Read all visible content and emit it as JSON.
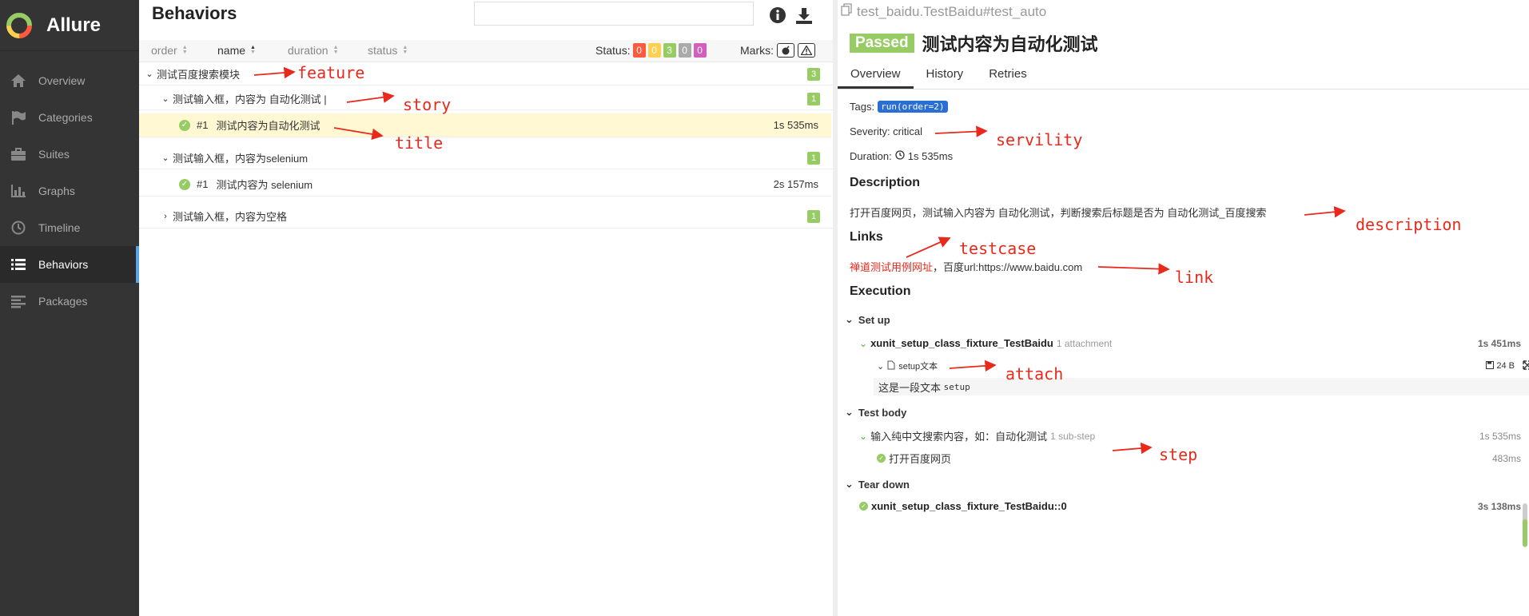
{
  "app": {
    "name": "Allure"
  },
  "sidebar": {
    "items": [
      {
        "label": "Overview",
        "icon": "home-icon"
      },
      {
        "label": "Categories",
        "icon": "flag-icon"
      },
      {
        "label": "Suites",
        "icon": "briefcase-icon"
      },
      {
        "label": "Graphs",
        "icon": "bar-chart-icon"
      },
      {
        "label": "Timeline",
        "icon": "clock-icon"
      },
      {
        "label": "Behaviors",
        "icon": "list-icon",
        "active": true
      },
      {
        "label": "Packages",
        "icon": "align-left-icon"
      }
    ]
  },
  "left": {
    "title": "Behaviors",
    "search_value": "",
    "sort_headers": [
      "order",
      "name",
      "duration",
      "status"
    ],
    "status_label": "Status:",
    "status_counts": [
      {
        "value": "0",
        "color": "#fd5a3e"
      },
      {
        "value": "0",
        "color": "#ffd050"
      },
      {
        "value": "3",
        "color": "#97cc64"
      },
      {
        "value": "0",
        "color": "#aaaaaa"
      },
      {
        "value": "0",
        "color": "#d35ebe"
      }
    ],
    "marks_label": "Marks:",
    "tree": {
      "feature": {
        "label": "测试百度搜索模块",
        "count": "3"
      },
      "stories": [
        {
          "label": "测试输入框，内容为 自动化测试 |",
          "count": "1",
          "test": {
            "num": "#1",
            "label": "测试内容为自动化测试",
            "duration": "1s 535ms"
          }
        },
        {
          "label": "测试输入框，内容为selenium",
          "count": "1",
          "test": {
            "num": "#1",
            "label": "测试内容为 selenium",
            "duration": "2s 157ms"
          }
        },
        {
          "label": "测试输入框，内容为空格",
          "count": "1"
        }
      ]
    }
  },
  "right": {
    "breadcrumb": "test_baidu.TestBaidu#test_auto",
    "status": "Passed",
    "title": "测试内容为自动化测试",
    "tabs": [
      "Overview",
      "History",
      "Retries"
    ],
    "tags_label": "Tags:",
    "tag": "run(order=2)",
    "severity": "Severity: critical",
    "duration_label": "Duration:",
    "duration": "1s 535ms",
    "description_heading": "Description",
    "description": "打开百度网页，测试输入内容为 自动化测试，判断搜索后标题是否为 自动化测试_百度搜索",
    "links_heading": "Links",
    "link_testcase": "禅道测试用例网址",
    "link_sep": "，",
    "link_url": "百度url:https://www.baidu.com",
    "execution_heading": "Execution",
    "setup": {
      "heading": "Set up",
      "fixture": "xunit_setup_class_fixture_TestBaidu",
      "fixture_meta": "1 attachment",
      "fixture_time": "1s 451ms",
      "attachment": "setup文本",
      "attachment_size": "24 B",
      "attachment_text_cn": "这是一段文本",
      "attachment_text_code": "setup"
    },
    "body": {
      "heading": "Test body",
      "step": "输入纯中文搜索内容，如：自动化测试",
      "step_meta": "1 sub-step",
      "step_time": "1s 535ms",
      "substep": "打开百度网页",
      "substep_time": "483ms"
    },
    "teardown": {
      "heading": "Tear down",
      "fixture": "xunit_setup_class_fixture_TestBaidu::0",
      "fixture_time": "3s 138ms"
    }
  },
  "annotations": {
    "feature": "feature",
    "story": "story",
    "title": "title",
    "servility": "servility",
    "description": "description",
    "testcase": "testcase",
    "link": "link",
    "attach": "attach",
    "step": "step"
  }
}
